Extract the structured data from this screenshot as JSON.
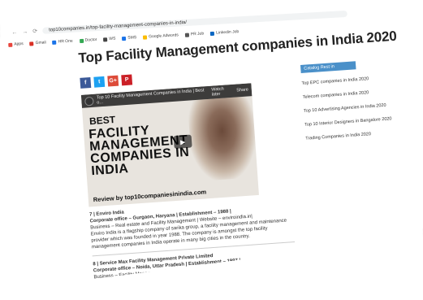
{
  "browser": {
    "url": "top10companies.in/top-facility-management-companies-in-india/",
    "bookmarks": [
      {
        "label": "Apps",
        "color": "#e8453c"
      },
      {
        "label": "Gmail",
        "color": "#d93025"
      },
      {
        "label": "HR One",
        "color": "#1a73e8"
      },
      {
        "label": "Doctor",
        "color": "#34a853"
      },
      {
        "label": "WS",
        "color": "#444444"
      },
      {
        "label": "SMS",
        "color": "#1a73e8"
      },
      {
        "label": "Google Adwords",
        "color": "#fbbc04"
      },
      {
        "label": "PR Job",
        "color": "#555555"
      },
      {
        "label": "Linkedin Job",
        "color": "#0a66c2"
      }
    ]
  },
  "page": {
    "title": "Top Facility Management companies in India 2020",
    "social": [
      {
        "label": "f",
        "color": "#3b5998"
      },
      {
        "label": "t",
        "color": "#1da1f2"
      },
      {
        "label": "G+",
        "color": "#dd4b39"
      },
      {
        "label": "P",
        "color": "#cb2027"
      }
    ],
    "video": {
      "title": "Top 10 Facility Management Companies in India | Best o...",
      "watch_later": "Watch later",
      "share": "Share",
      "best": "BEST",
      "lines": [
        "FACILITY",
        "MANAGEMENT",
        "COMPANIES IN",
        "INDIA"
      ],
      "review": "Review by top10companiesinindia.com"
    },
    "entries": [
      {
        "heading": "7 | Enviro India",
        "office": "Corporate office – Gurgaon, Haryana | Establishment – 1988 |",
        "business": "Business – Real estate and Facility Management | Website – enviroindia.in|",
        "desc": "Enviro India is a flagship company of sarika group, a facility management and maintenance provider which was founded in year 1988. The company is amongst the top facility management companies in India operate in many big cities in the country."
      },
      {
        "heading": "8 | Service Max Facility Management Private Limited",
        "office": "Corporate office – Noida, Uttar Pradesh | Establishment – 1997 |",
        "business": "Business – Facility Management | Website – servicemaxindia.com |",
        "desc": ""
      }
    ]
  },
  "sidebar": {
    "heading": "Catalog Rest in",
    "links": [
      "Top EPC companies in India 2020",
      "Telecom companies in India 2020",
      "Top 10 Advertising Agencies in India 2020",
      "Top 10 Interior Designers in Bangalore 2020",
      "Trading Companies in India 2020"
    ]
  }
}
